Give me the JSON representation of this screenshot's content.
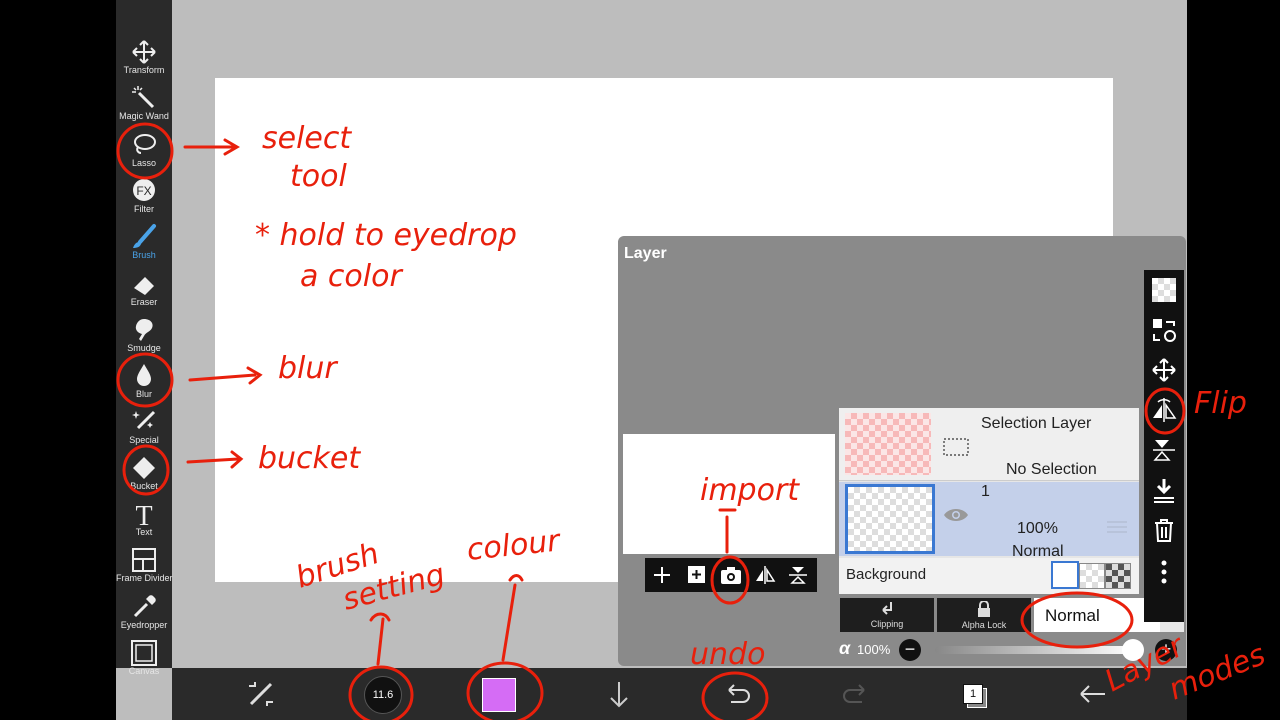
{
  "tools": [
    {
      "label": "Transform",
      "icon": "move-icon"
    },
    {
      "label": "Magic Wand",
      "icon": "magic-wand-icon"
    },
    {
      "label": "Lasso",
      "icon": "lasso-icon"
    },
    {
      "label": "Filter",
      "icon": "fx-icon"
    },
    {
      "label": "Brush",
      "icon": "brush-icon",
      "active": true
    },
    {
      "label": "Eraser",
      "icon": "eraser-icon"
    },
    {
      "label": "Smudge",
      "icon": "smudge-icon"
    },
    {
      "label": "Blur",
      "icon": "droplet-icon"
    },
    {
      "label": "Special",
      "icon": "sparkle-icon"
    },
    {
      "label": "Bucket",
      "icon": "bucket-icon"
    },
    {
      "label": "Text",
      "icon": "text-icon"
    },
    {
      "label": "Frame Divider",
      "icon": "frame-divider-icon"
    },
    {
      "label": "Eyedropper",
      "icon": "eyedropper-icon"
    },
    {
      "label": "Canvas",
      "icon": "canvas-icon"
    }
  ],
  "layer_panel": {
    "title": "Layer",
    "selection_layer": {
      "name": "Selection Layer",
      "status": "No Selection"
    },
    "layer1": {
      "number": "1",
      "opacity": "100%",
      "blend": "Normal"
    },
    "background_label": "Background",
    "clipping_label": "Clipping",
    "alpha_lock_label": "Alpha Lock",
    "blend_mode": "Normal",
    "alpha_symbol": "α",
    "alpha_value": "100%"
  },
  "bottom_bar": {
    "brush_size": "11.6",
    "color": "#d56cf5",
    "page": "1"
  },
  "colors": {
    "accent": "#4aa3e8",
    "annotation": "#e8200c"
  },
  "annotations": [
    "select",
    "tool",
    "* hold to eyedrop",
    "a color",
    "blur",
    "bucket",
    "brush",
    "setting",
    "colour",
    "import",
    "undo",
    "Flip",
    "Layer",
    "modes"
  ]
}
